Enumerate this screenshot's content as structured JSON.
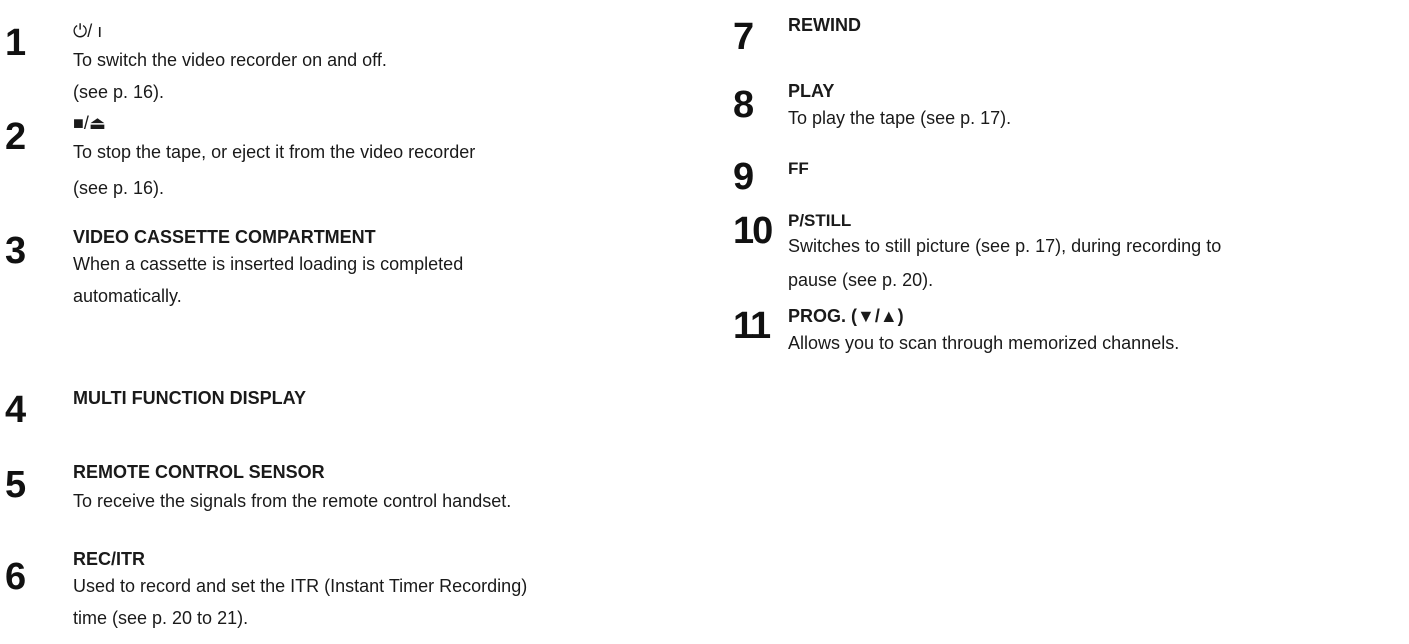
{
  "items": [
    {
      "number": "1",
      "title": "⏻/ ı",
      "desc": [
        "To switch the video recorder on and off.",
        "(see p. 16)."
      ]
    },
    {
      "number": "2",
      "title": "■/⏏",
      "desc": [
        "To stop the tape, or eject it from the video recorder",
        "(see p. 16)."
      ]
    },
    {
      "number": "3",
      "title": "VIDEO CASSETTE COMPARTMENT",
      "desc": [
        "When a cassette is inserted loading is completed",
        "automatically."
      ]
    },
    {
      "number": "4",
      "title": "MULTI FUNCTION DISPLAY",
      "desc": []
    },
    {
      "number": "5",
      "title": "REMOTE CONTROL SENSOR",
      "desc": [
        "To receive the signals from the remote control handset."
      ]
    },
    {
      "number": "6",
      "title": "REC/ITR",
      "desc": [
        "Used to record and set the ITR (Instant Timer Recording)",
        "time (see p. 20 to 21)."
      ]
    },
    {
      "number": "7",
      "title": "REWIND",
      "desc": []
    },
    {
      "number": "8",
      "title": "PLAY",
      "desc": [
        "To play the tape (see p. 17)."
      ]
    },
    {
      "number": "9",
      "title": "FF",
      "desc": []
    },
    {
      "number": "10",
      "title": "P/STILL",
      "desc": [
        "Switches to still picture (see p. 17), during recording to",
        "pause (see p. 20)."
      ]
    },
    {
      "number": "11",
      "title": "PROG. (▼/▲)",
      "desc": [
        "Allows you to scan through memorized channels."
      ]
    }
  ]
}
